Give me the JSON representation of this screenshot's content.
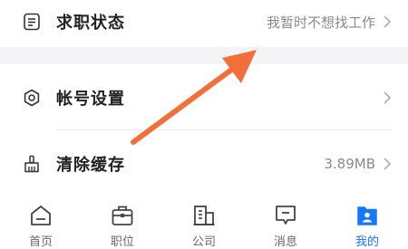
{
  "settings": {
    "job_status": {
      "label": "求职状态",
      "value": "我暂时不想找工作"
    },
    "account": {
      "label": "帐号设置"
    },
    "cache": {
      "label": "清除缓存",
      "value": "3.89MB"
    }
  },
  "tabbar": {
    "tabs": [
      {
        "label": "首页",
        "icon": "home-icon"
      },
      {
        "label": "职位",
        "icon": "briefcase-icon"
      },
      {
        "label": "公司",
        "icon": "company-icon"
      },
      {
        "label": "消息",
        "icon": "message-icon"
      },
      {
        "label": "我的",
        "icon": "profile-icon",
        "active": true
      }
    ]
  },
  "colors": {
    "accent": "#1677ff",
    "arrow": "#f26f3a",
    "muted_text": "#8a8a8a",
    "section_gap": "#f4f4f6"
  }
}
